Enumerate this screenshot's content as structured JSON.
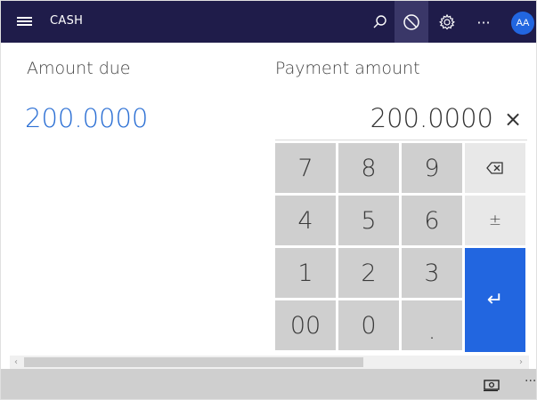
{
  "header": {
    "title": "CASH",
    "avatar_initials": "AA",
    "more_glyph": "···"
  },
  "payment": {
    "amount_due_label": "Amount due",
    "payment_amount_label": "Payment amount",
    "amount_due_value": "200.0000",
    "payment_amount_value": "200.0000",
    "clear_glyph": "×"
  },
  "keypad": {
    "k7": "7",
    "k8": "8",
    "k9": "9",
    "k4": "4",
    "k5": "5",
    "k6": "6",
    "k1": "1",
    "k2": "2",
    "k3": "3",
    "k00": "00",
    "k0": "0",
    "kdot": ".",
    "plusminus": "±",
    "enter_glyph": "↵"
  },
  "scroll": {
    "left": "‹",
    "right": "›"
  },
  "footer": {
    "more_glyph": "···"
  },
  "colors": {
    "header_bg": "#1f1c4a",
    "accent": "#2266e0",
    "key_bg": "#cfcfcf"
  }
}
